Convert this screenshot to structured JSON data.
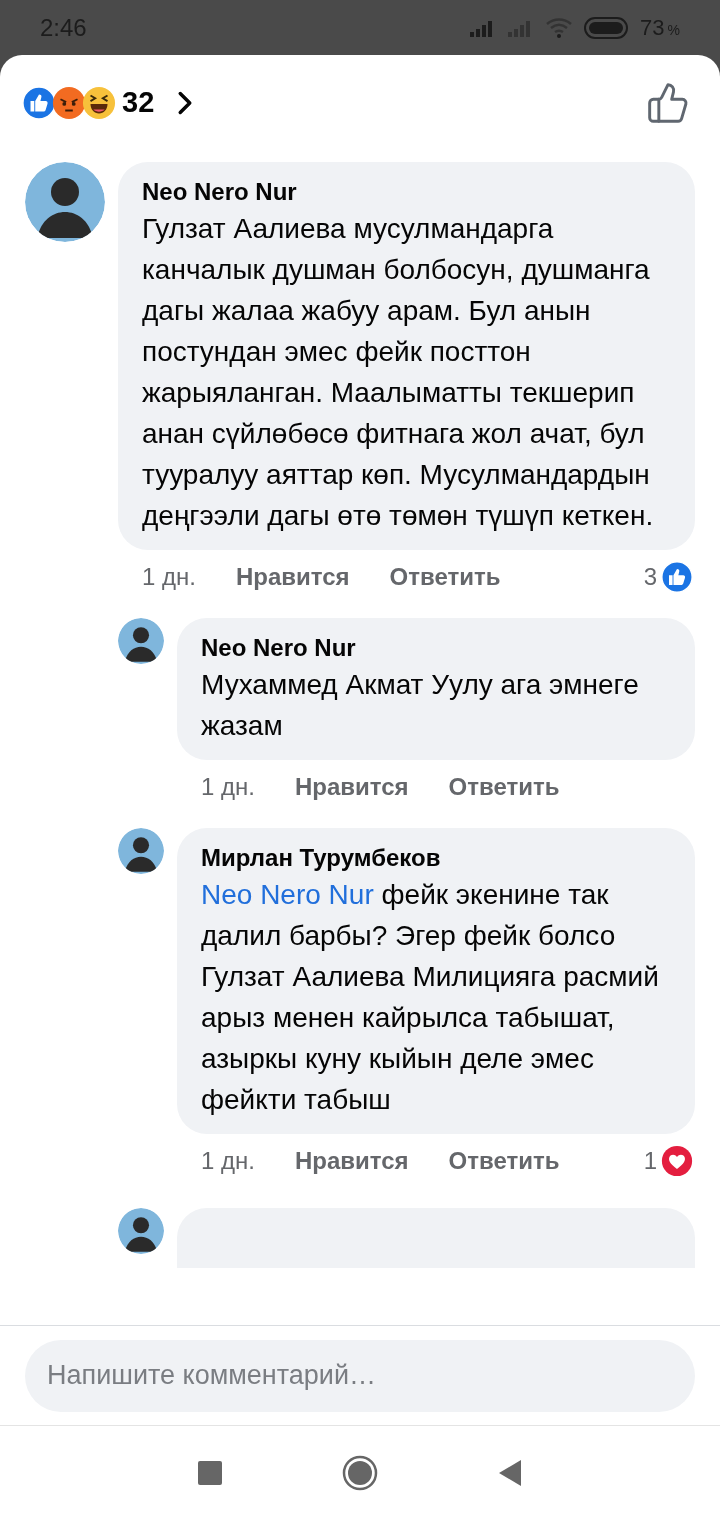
{
  "status_bar": {
    "time": "2:46",
    "battery": "73",
    "battery_unit": "%"
  },
  "header": {
    "reactions": [
      {
        "kind": "like"
      },
      {
        "kind": "angry"
      },
      {
        "kind": "haha"
      }
    ],
    "count": "32"
  },
  "comments": [
    {
      "kind": "full",
      "author": "Neo Nero Nur",
      "text": "Гулзат Аалиева мусулмандарга канчалык душман болбосун, душманга дагы жалаа жабуу арам. Бул анын постундан эмес фейк посттон жарыяланган. Маалыматты текшерип анан сүйлөбөсө фитнага жол ачат, бул тууралуу аяттар көп. Мусулмандардын деңгээли дагы өтө төмөн түшүп кеткен.",
      "time": "1 дн.",
      "like_label": "Нравится",
      "reply_label": "Ответить",
      "reaction": {
        "count": "3",
        "kind": "like"
      },
      "replies": [
        {
          "kind": "full",
          "author": "Neo Nero Nur",
          "text": "Мухаммед Акмат Уулу ага эмнеге жазам",
          "time": "1 дн.",
          "like_label": "Нравится",
          "reply_label": "Ответить"
        },
        {
          "kind": "full",
          "author": "Мирлан Турумбеков",
          "mention": "Neo Nero Nur",
          "text": "фейк экенине так далил барбы? Эгер фейк болсо Гулзат Аалиева Милицияга расмий арыз менен кайрылса табышат, азыркы куну кыйын деле эмес фейкти табыш",
          "time": "1 дн.",
          "like_label": "Нравится",
          "reply_label": "Ответить",
          "reaction": {
            "count": "1",
            "kind": "love"
          }
        },
        {
          "kind": "cut"
        }
      ]
    }
  ],
  "composer": {
    "placeholder": "Напишите комментарий…"
  }
}
